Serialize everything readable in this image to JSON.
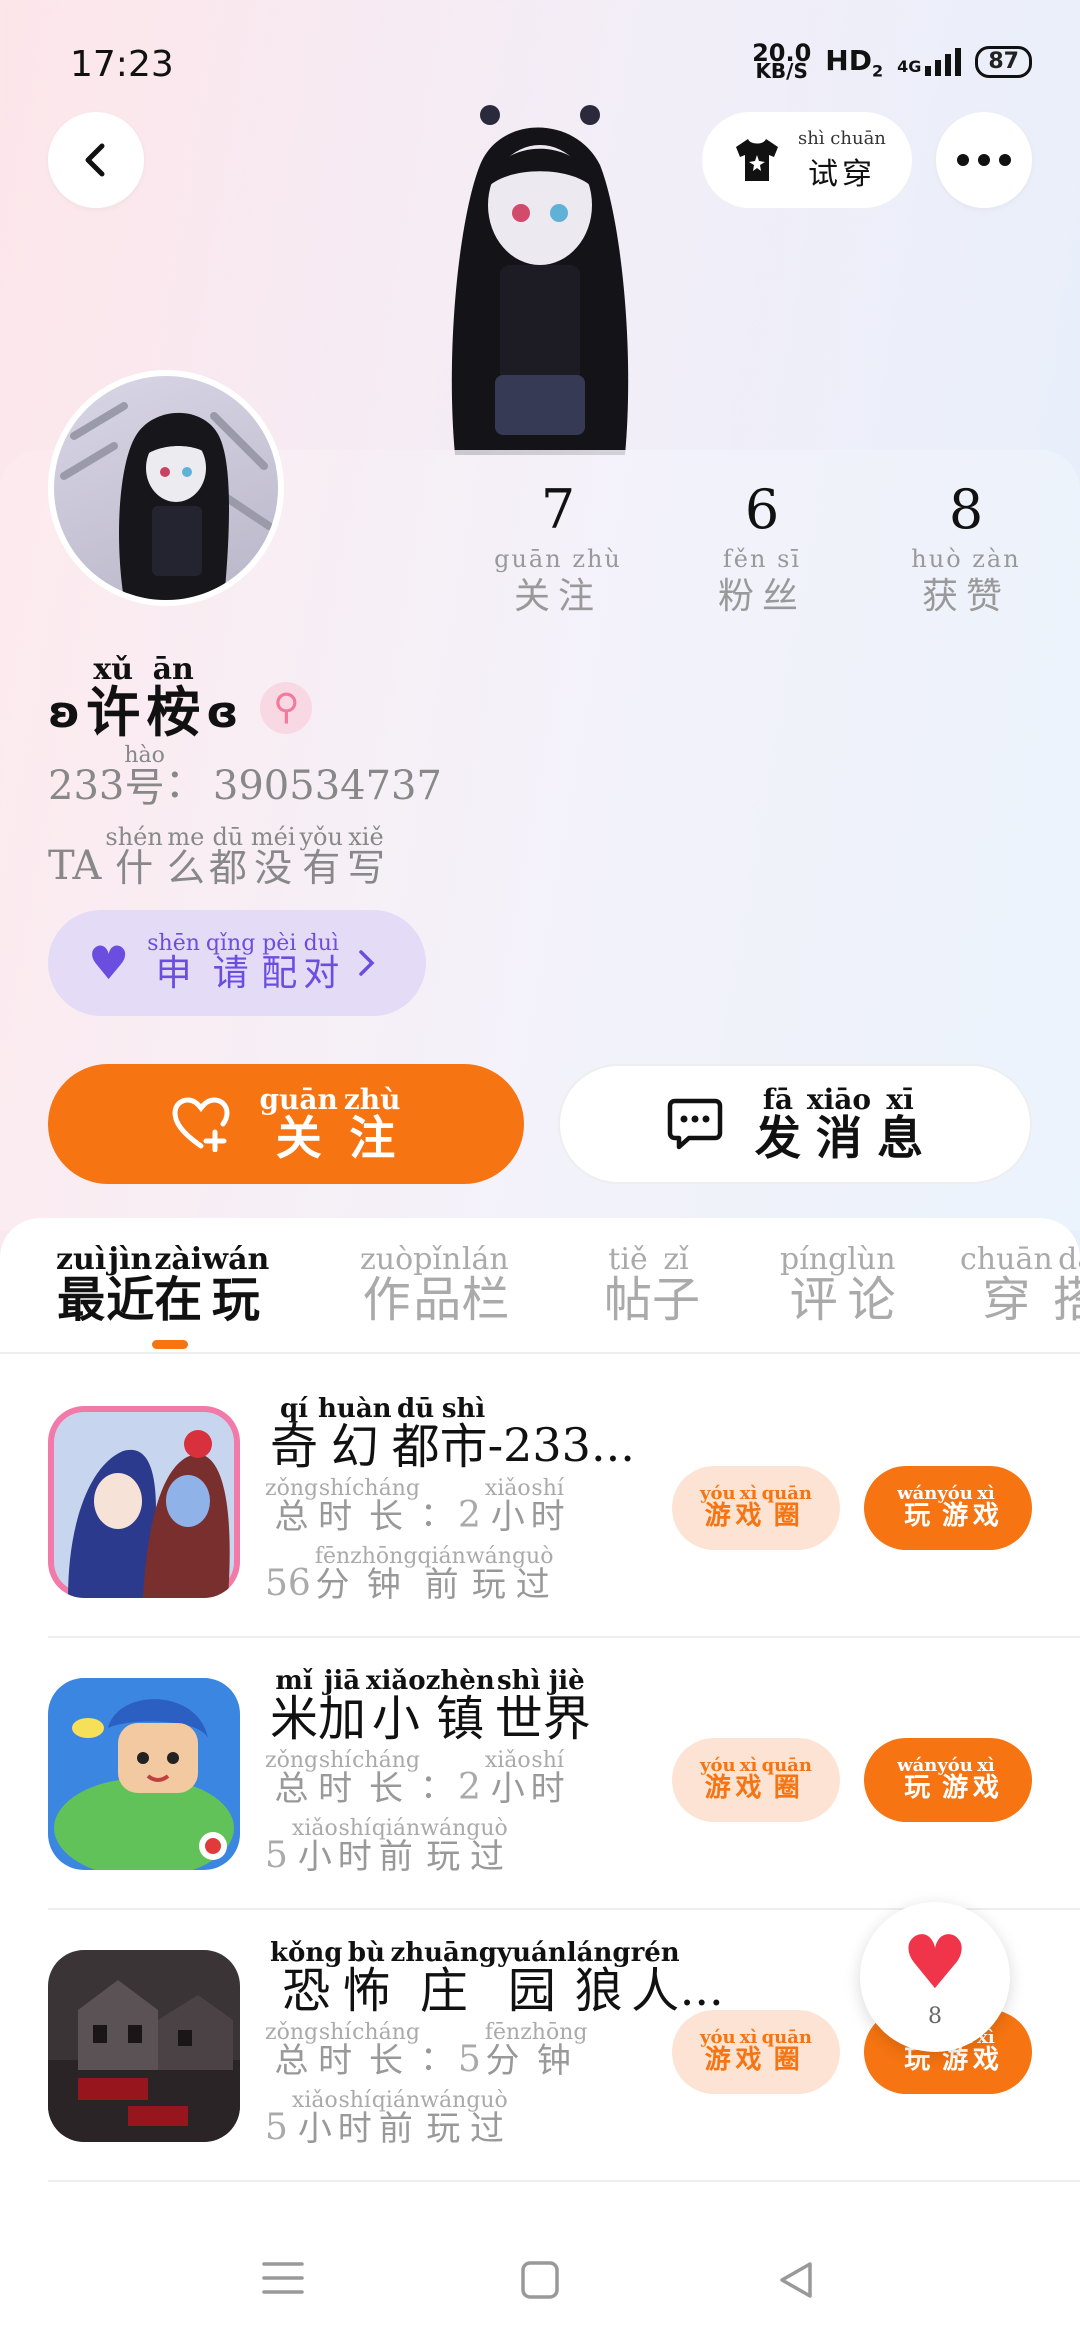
{
  "status_bar": {
    "time": "17:23",
    "net_speed_top": "20.0",
    "net_speed_unit": "KB/S",
    "hd": "HD",
    "hd_sub": "2",
    "signal": "4G",
    "battery": "87"
  },
  "header": {
    "tryon_py": "shì chuān",
    "tryon_label": "试穿"
  },
  "profile": {
    "stats": [
      {
        "value": "7",
        "py": "guān zhù",
        "label": "关注"
      },
      {
        "value": "6",
        "py": "fěn sī",
        "label": "粉丝"
      },
      {
        "value": "8",
        "py": "huò zàn",
        "label": "获赞"
      }
    ],
    "name_prefix": "ʚ",
    "name_suffix": "ɞ",
    "name_chars": [
      {
        "py": "xǔ",
        "ch": "许"
      },
      {
        "py": "ān",
        "ch": "桉"
      }
    ],
    "gender_symbol": "⚲",
    "id_prefix": "233",
    "id_hao_py": "hào",
    "id_hao": "号",
    "id_colon": "：",
    "id_value": "390534737",
    "bio_prefix": "TA",
    "bio_chars": [
      {
        "py": "shén",
        "ch": "什"
      },
      {
        "py": "me",
        "ch": "么"
      },
      {
        "py": "dū",
        "ch": "都"
      },
      {
        "py": "méi",
        "ch": "没"
      },
      {
        "py": "yǒu",
        "ch": "有"
      },
      {
        "py": "xiě",
        "ch": "写"
      }
    ],
    "pair_chars": [
      {
        "py": "shēn",
        "ch": "申"
      },
      {
        "py": "qǐng",
        "ch": "请"
      },
      {
        "py": "pèi",
        "ch": "配"
      },
      {
        "py": "duì",
        "ch": "对"
      }
    ]
  },
  "actions": {
    "follow_chars": [
      {
        "py": "guān",
        "ch": "关"
      },
      {
        "py": "zhù",
        "ch": "注"
      }
    ],
    "message_chars": [
      {
        "py": "fā",
        "ch": "发"
      },
      {
        "py": "xiāo",
        "ch": "消"
      },
      {
        "py": "xī",
        "ch": "息"
      }
    ]
  },
  "tabs": [
    {
      "chars": [
        {
          "py": "zuì",
          "ch": "最"
        },
        {
          "py": "jìn",
          "ch": "近"
        },
        {
          "py": "zài",
          "ch": "在"
        },
        {
          "py": "wán",
          "ch": "玩"
        }
      ]
    },
    {
      "chars": [
        {
          "py": "zuò",
          "ch": "作"
        },
        {
          "py": "pǐn",
          "ch": "品"
        },
        {
          "py": "lán",
          "ch": "栏"
        }
      ]
    },
    {
      "chars": [
        {
          "py": "tiě",
          "ch": "帖"
        },
        {
          "py": "zǐ",
          "ch": "子"
        }
      ]
    },
    {
      "chars": [
        {
          "py": "píng",
          "ch": "评"
        },
        {
          "py": "lùn",
          "ch": "论"
        }
      ]
    },
    {
      "chars": [
        {
          "py": "chuān",
          "ch": "穿"
        },
        {
          "py": "dā",
          "ch": "搭"
        }
      ]
    }
  ],
  "games": [
    {
      "name_chars": [
        {
          "py": "qí",
          "ch": "奇"
        },
        {
          "py": "huàn",
          "ch": "幻"
        },
        {
          "py": "dū",
          "ch": "都"
        },
        {
          "py": "shì",
          "ch": "市"
        }
      ],
      "name_tail": "-233...",
      "duration_num": "2",
      "duration_unit": [
        {
          "py": "xiǎo",
          "ch": "小"
        },
        {
          "py": "shí",
          "ch": "时"
        }
      ],
      "last_num": "56",
      "last_chars": [
        {
          "py": "fēn",
          "ch": "分"
        },
        {
          "py": "zhōng",
          "ch": "钟"
        },
        {
          "py": "qián",
          "ch": "前"
        },
        {
          "py": "wán",
          "ch": "玩"
        },
        {
          "py": "guò",
          "ch": "过"
        }
      ]
    },
    {
      "name_chars": [
        {
          "py": "mǐ",
          "ch": "米"
        },
        {
          "py": "jiā",
          "ch": "加"
        },
        {
          "py": "xiǎo",
          "ch": "小"
        },
        {
          "py": "zhèn",
          "ch": "镇"
        },
        {
          "py": "shì",
          "ch": "世"
        },
        {
          "py": "jiè",
          "ch": "界"
        }
      ],
      "name_tail": "",
      "duration_num": "2",
      "duration_unit": [
        {
          "py": "xiǎo",
          "ch": "小"
        },
        {
          "py": "shí",
          "ch": "时"
        }
      ],
      "last_num": "5",
      "last_chars": [
        {
          "py": "xiǎo",
          "ch": "小"
        },
        {
          "py": "shí",
          "ch": "时"
        },
        {
          "py": "qián",
          "ch": "前"
        },
        {
          "py": "wán",
          "ch": "玩"
        },
        {
          "py": "guò",
          "ch": "过"
        }
      ]
    },
    {
      "name_chars": [
        {
          "py": "kǒng",
          "ch": "恐"
        },
        {
          "py": "bù",
          "ch": "怖"
        },
        {
          "py": "zhuāng",
          "ch": "庄"
        },
        {
          "py": "yuán",
          "ch": "园"
        },
        {
          "py": "láng",
          "ch": "狼"
        },
        {
          "py": "rén",
          "ch": "人"
        }
      ],
      "name_tail": "...",
      "duration_num": "5",
      "duration_unit": [
        {
          "py": "fēn",
          "ch": "分"
        },
        {
          "py": "zhōng",
          "ch": "钟"
        }
      ],
      "last_num": "5",
      "last_chars": [
        {
          "py": "xiǎo",
          "ch": "小"
        },
        {
          "py": "shí",
          "ch": "时"
        },
        {
          "py": "qián",
          "ch": "前"
        },
        {
          "py": "wán",
          "ch": "玩"
        },
        {
          "py": "guò",
          "ch": "过"
        }
      ]
    }
  ],
  "game_labels": {
    "total_chars": [
      {
        "py": "zǒng",
        "ch": "总"
      },
      {
        "py": "shí",
        "ch": "时"
      },
      {
        "py": "cháng",
        "ch": "长"
      }
    ],
    "colon": "：",
    "circle_chars": [
      {
        "py": "yóu",
        "ch": "游"
      },
      {
        "py": "xì",
        "ch": "戏"
      },
      {
        "py": "quān",
        "ch": "圈"
      }
    ],
    "play_chars": [
      {
        "py": "wán",
        "ch": "玩"
      },
      {
        "py": "yóu",
        "ch": "游"
      },
      {
        "py": "xì",
        "ch": "戏"
      }
    ]
  },
  "floating_like": {
    "count": "8"
  },
  "colors": {
    "accent": "#f67411",
    "purple": "#6b4ee0",
    "heart": "#f0344a"
  }
}
